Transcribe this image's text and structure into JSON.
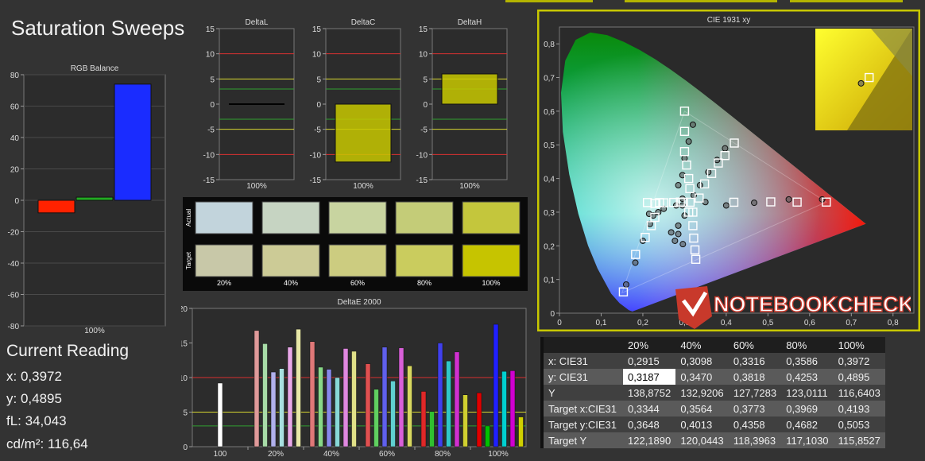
{
  "page_title": "Saturation Sweeps",
  "rgb_balance": {
    "title": "RGB Balance",
    "yticks": [
      "80",
      "60",
      "40",
      "20",
      "0",
      "-20",
      "-40",
      "-60",
      "-80"
    ],
    "xlabel": "100%",
    "values": {
      "red": -8,
      "green": 2,
      "blue": 74
    },
    "colors": {
      "red": "#ff2200",
      "green": "#22aa22",
      "blue": "#1a2cff"
    }
  },
  "delta_charts": [
    {
      "title": "DeltaL",
      "xlabel": "100%",
      "value": 0,
      "color": "#000000"
    },
    {
      "title": "DeltaC",
      "xlabel": "100%",
      "value": -11.5,
      "color": "#c8c800"
    },
    {
      "title": "DeltaH",
      "xlabel": "100%",
      "value": 6,
      "color": "#c8c800"
    }
  ],
  "delta_yticks": [
    "15",
    "10",
    "5",
    "0",
    "-5",
    "-10",
    "-15"
  ],
  "swatches": {
    "actual_label": "Actual",
    "target_label": "Target",
    "labels": [
      "20%",
      "40%",
      "60%",
      "80%",
      "100%"
    ],
    "actual": [
      "#c2d4dc",
      "#c6d4c2",
      "#c8d4a0",
      "#c4cc78",
      "#c4c63c"
    ],
    "target": [
      "#c8c8a8",
      "#cccb96",
      "#cccc80",
      "#cacc5e",
      "#c6c400"
    ]
  },
  "deltae": {
    "title": "DeltaE 2000",
    "yticks": [
      "20",
      "15",
      "10",
      "5",
      "0"
    ],
    "xlabels": [
      "100",
      "20%",
      "40%",
      "60%",
      "80%",
      "100%"
    ],
    "groups": [
      {
        "bars": [
          {
            "v": 9.2,
            "c": "#ffffff"
          }
        ]
      },
      {
        "bars": [
          {
            "v": 16.8,
            "c": "#e09a9a"
          },
          {
            "v": 14.9,
            "c": "#a8dca8"
          },
          {
            "v": 10.8,
            "c": "#b0b0ec"
          },
          {
            "v": 11.3,
            "c": "#a8e0e0"
          },
          {
            "v": 14.4,
            "c": "#e8a8e8"
          },
          {
            "v": 17.0,
            "c": "#e8e8a8"
          }
        ]
      },
      {
        "bars": [
          {
            "v": 15.2,
            "c": "#e07878"
          },
          {
            "v": 11.5,
            "c": "#88d888"
          },
          {
            "v": 11.2,
            "c": "#8888ec"
          },
          {
            "v": 10.0,
            "c": "#88d8d8"
          },
          {
            "v": 14.2,
            "c": "#e088e0"
          },
          {
            "v": 13.8,
            "c": "#e0e088"
          }
        ]
      },
      {
        "bars": [
          {
            "v": 12.0,
            "c": "#e05050"
          },
          {
            "v": 8.3,
            "c": "#60d060"
          },
          {
            "v": 14.4,
            "c": "#6060ec"
          },
          {
            "v": 9.5,
            "c": "#60d0d0"
          },
          {
            "v": 14.3,
            "c": "#d860d8"
          },
          {
            "v": 11.7,
            "c": "#d8d860"
          }
        ]
      },
      {
        "bars": [
          {
            "v": 8.0,
            "c": "#e02828"
          },
          {
            "v": 5.1,
            "c": "#30c030"
          },
          {
            "v": 15.0,
            "c": "#4040ec"
          },
          {
            "v": 12.4,
            "c": "#30c8c8"
          },
          {
            "v": 13.7,
            "c": "#d030d0"
          },
          {
            "v": 7.5,
            "c": "#d0d030"
          }
        ]
      },
      {
        "bars": [
          {
            "v": 7.8,
            "c": "#e00000"
          },
          {
            "v": 3.0,
            "c": "#00c000"
          },
          {
            "v": 17.7,
            "c": "#2020ff"
          },
          {
            "v": 10.9,
            "c": "#00d0d0"
          },
          {
            "v": 11.0,
            "c": "#d000d0"
          },
          {
            "v": 4.3,
            "c": "#d0d000"
          }
        ]
      }
    ]
  },
  "cie": {
    "title": "CIE 1931 xy",
    "xticks": [
      "0",
      "0,1",
      "0,2",
      "0,3",
      "0,4",
      "0,5",
      "0,6",
      "0,7",
      "0,8"
    ],
    "yticks": [
      "0,8",
      "0,7",
      "0,6",
      "0,5",
      "0,4",
      "0,3",
      "0,2",
      "0,1",
      "0"
    ],
    "targets": [
      [
        0.1533,
        0.0633
      ],
      [
        0.1826,
        0.1745
      ],
      [
        0.2057,
        0.2251
      ],
      [
        0.2202,
        0.26
      ],
      [
        0.2288,
        0.2846
      ],
      [
        0.2288,
        0.3258
      ],
      [
        0.2504,
        0.3279
      ],
      [
        0.2741,
        0.329
      ],
      [
        0.2975,
        0.3294
      ],
      [
        0.3133,
        0.3295
      ],
      [
        0.211,
        0.3286
      ],
      [
        0.24,
        0.3285
      ],
      [
        0.29,
        0.33
      ],
      [
        0.4183,
        0.3295
      ],
      [
        0.5068,
        0.3306
      ],
      [
        0.57,
        0.33
      ],
      [
        0.64,
        0.33
      ],
      [
        0.3,
        0.6
      ],
      [
        0.3,
        0.54
      ],
      [
        0.3,
        0.48
      ],
      [
        0.305,
        0.44
      ],
      [
        0.31,
        0.4
      ],
      [
        0.3127,
        0.37
      ],
      [
        0.381,
        0.446
      ],
      [
        0.365,
        0.415
      ],
      [
        0.348,
        0.384
      ],
      [
        0.4193,
        0.5053
      ],
      [
        0.3969,
        0.4682
      ],
      [
        0.335,
        0.342
      ],
      [
        0.32,
        0.3
      ],
      [
        0.32,
        0.26
      ],
      [
        0.322,
        0.223
      ],
      [
        0.325,
        0.188
      ],
      [
        0.327,
        0.16
      ],
      [
        0.31,
        0.3
      ]
    ],
    "measured": [
      [
        0.16,
        0.085
      ],
      [
        0.182,
        0.15
      ],
      [
        0.2,
        0.215
      ],
      [
        0.217,
        0.265
      ],
      [
        0.225,
        0.29
      ],
      [
        0.215,
        0.295
      ],
      [
        0.237,
        0.3
      ],
      [
        0.25,
        0.31
      ],
      [
        0.28,
        0.32
      ],
      [
        0.295,
        0.32
      ],
      [
        0.32,
        0.56
      ],
      [
        0.31,
        0.51
      ],
      [
        0.3,
        0.46
      ],
      [
        0.295,
        0.41
      ],
      [
        0.285,
        0.38
      ],
      [
        0.295,
        0.34
      ],
      [
        0.35,
        0.33
      ],
      [
        0.4,
        0.32
      ],
      [
        0.467,
        0.328
      ],
      [
        0.55,
        0.338
      ],
      [
        0.63,
        0.338
      ],
      [
        0.3972,
        0.4895
      ],
      [
        0.378,
        0.455
      ],
      [
        0.357,
        0.419
      ],
      [
        0.337,
        0.38
      ],
      [
        0.322,
        0.35
      ],
      [
        0.285,
        0.26
      ],
      [
        0.285,
        0.235
      ],
      [
        0.296,
        0.205
      ],
      [
        0.277,
        0.215
      ],
      [
        0.3,
        0.29
      ],
      [
        0.268,
        0.24
      ]
    ],
    "zoom_target": [
      0.4193,
      0.5053
    ],
    "zoom_measured": [
      0.3972,
      0.4895
    ]
  },
  "watermark": "NOTEBOOKCHECK",
  "reading": {
    "title": "Current Reading",
    "lines": [
      "x: 0,3972",
      "y: 0,4895",
      "fL: 34,043",
      "cd/m²: 116,64"
    ]
  },
  "table": {
    "headers": [
      "",
      "20%",
      "40%",
      "60%",
      "80%",
      "100%"
    ],
    "rows": [
      [
        "x: CIE31",
        "0,2915",
        "0,3098",
        "0,3316",
        "0,3586",
        "0,3972"
      ],
      [
        "y: CIE31",
        "0,3187",
        "0,3470",
        "0,3818",
        "0,4253",
        "0,4895"
      ],
      [
        "Y",
        "138,8752",
        "132,9206",
        "127,7283",
        "123,0111",
        "116,6403"
      ],
      [
        "Target x:CIE31",
        "0,3344",
        "0,3564",
        "0,3773",
        "0,3969",
        "0,4193"
      ],
      [
        "Target y:CIE31",
        "0,3648",
        "0,4013",
        "0,4358",
        "0,4682",
        "0,5053"
      ],
      [
        "Target Y",
        "122,1890",
        "120,0443",
        "118,3963",
        "117,1030",
        "115,8527"
      ]
    ]
  }
}
